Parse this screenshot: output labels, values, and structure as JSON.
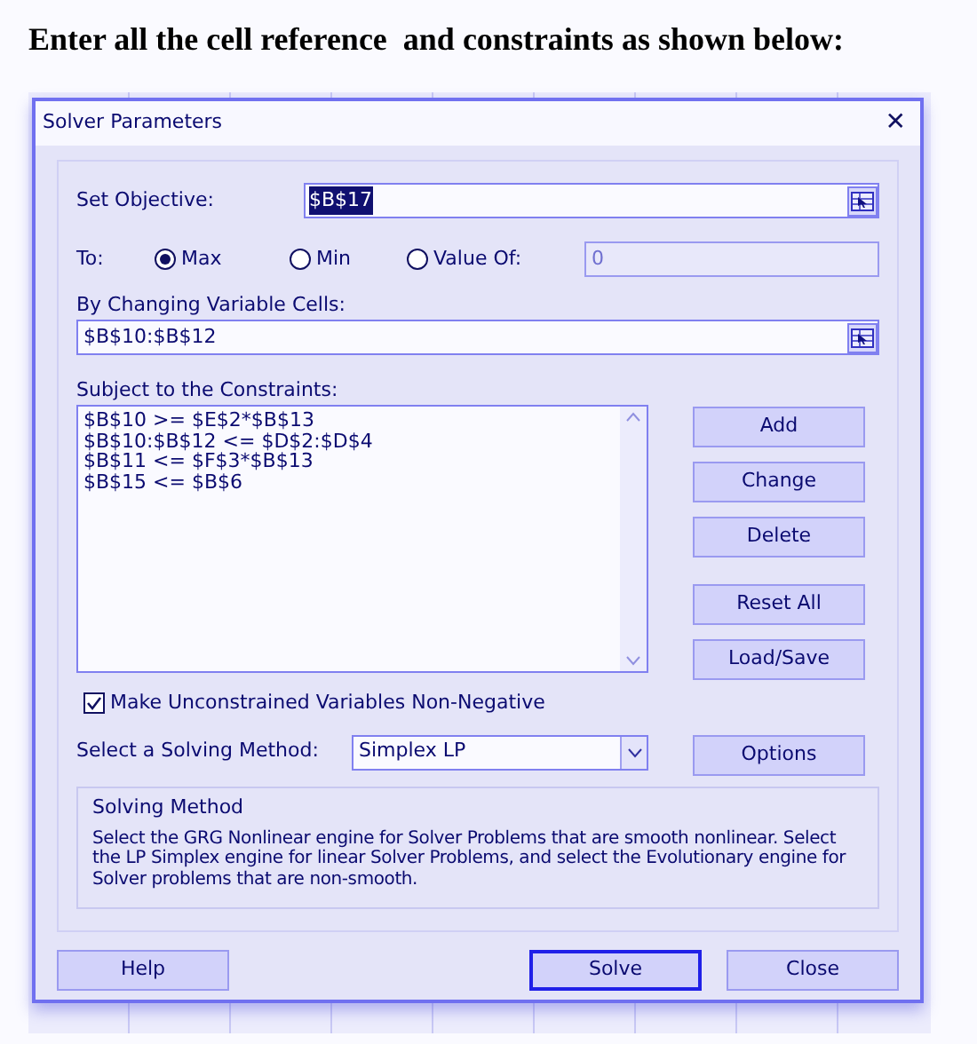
{
  "heading": "Enter all the cell reference  and constraints as shown below:",
  "window": {
    "title": "Solver Parameters",
    "close": "✕"
  },
  "objective": {
    "label": "Set Objective:",
    "value": "$B$17",
    "selected": true
  },
  "to": {
    "label": "To:",
    "options": [
      {
        "label": "Max",
        "selected": true
      },
      {
        "label": "Min",
        "selected": false
      },
      {
        "label": "Value Of:",
        "selected": false
      }
    ],
    "value_field": "0"
  },
  "changing_cells": {
    "label": "By Changing Variable Cells:",
    "value": "$B$10:$B$12"
  },
  "constraints": {
    "label": "Subject to the Constraints:",
    "items": [
      "$B$10 >= $E$2*$B$13",
      "$B$10:$B$12 <= $D$2:$D$4",
      "$B$11 <= $F$3*$B$13",
      "$B$15 <= $B$6"
    ]
  },
  "side_buttons": [
    "Add",
    "Change",
    "Delete",
    "Reset All",
    "Load/Save"
  ],
  "non_negative": {
    "label": "Make Unconstrained Variables Non-Negative",
    "checked": true
  },
  "method": {
    "label": "Select a Solving Method:",
    "value": "Simplex LP",
    "button": "Options"
  },
  "method_info": {
    "title": "Solving Method",
    "text": "Select the GRG Nonlinear engine for Solver Problems that are smooth nonlinear. Select the LP Simplex engine for linear Solver Problems, and select the Evolutionary engine for Solver problems that are non-smooth."
  },
  "footer_buttons": [
    {
      "label": "Help",
      "default": false
    },
    {
      "label": "Solve",
      "default": true
    },
    {
      "label": "Close",
      "default": false
    }
  ]
}
